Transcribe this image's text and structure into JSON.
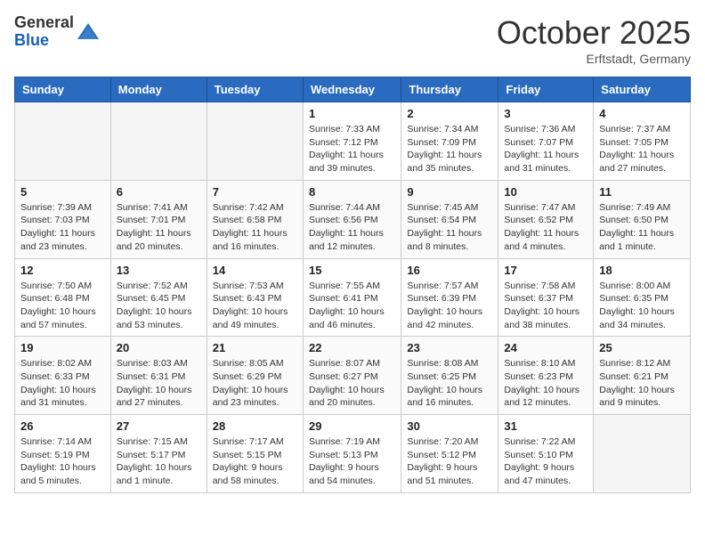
{
  "header": {
    "logo_general": "General",
    "logo_blue": "Blue",
    "month_title": "October 2025",
    "location": "Erftstadt, Germany"
  },
  "days_of_week": [
    "Sunday",
    "Monday",
    "Tuesday",
    "Wednesday",
    "Thursday",
    "Friday",
    "Saturday"
  ],
  "weeks": [
    [
      {
        "day": "",
        "info": ""
      },
      {
        "day": "",
        "info": ""
      },
      {
        "day": "",
        "info": ""
      },
      {
        "day": "1",
        "info": "Sunrise: 7:33 AM\nSunset: 7:12 PM\nDaylight: 11 hours and 39 minutes."
      },
      {
        "day": "2",
        "info": "Sunrise: 7:34 AM\nSunset: 7:09 PM\nDaylight: 11 hours and 35 minutes."
      },
      {
        "day": "3",
        "info": "Sunrise: 7:36 AM\nSunset: 7:07 PM\nDaylight: 11 hours and 31 minutes."
      },
      {
        "day": "4",
        "info": "Sunrise: 7:37 AM\nSunset: 7:05 PM\nDaylight: 11 hours and 27 minutes."
      }
    ],
    [
      {
        "day": "5",
        "info": "Sunrise: 7:39 AM\nSunset: 7:03 PM\nDaylight: 11 hours and 23 minutes."
      },
      {
        "day": "6",
        "info": "Sunrise: 7:41 AM\nSunset: 7:01 PM\nDaylight: 11 hours and 20 minutes."
      },
      {
        "day": "7",
        "info": "Sunrise: 7:42 AM\nSunset: 6:58 PM\nDaylight: 11 hours and 16 minutes."
      },
      {
        "day": "8",
        "info": "Sunrise: 7:44 AM\nSunset: 6:56 PM\nDaylight: 11 hours and 12 minutes."
      },
      {
        "day": "9",
        "info": "Sunrise: 7:45 AM\nSunset: 6:54 PM\nDaylight: 11 hours and 8 minutes."
      },
      {
        "day": "10",
        "info": "Sunrise: 7:47 AM\nSunset: 6:52 PM\nDaylight: 11 hours and 4 minutes."
      },
      {
        "day": "11",
        "info": "Sunrise: 7:49 AM\nSunset: 6:50 PM\nDaylight: 11 hours and 1 minute."
      }
    ],
    [
      {
        "day": "12",
        "info": "Sunrise: 7:50 AM\nSunset: 6:48 PM\nDaylight: 10 hours and 57 minutes."
      },
      {
        "day": "13",
        "info": "Sunrise: 7:52 AM\nSunset: 6:45 PM\nDaylight: 10 hours and 53 minutes."
      },
      {
        "day": "14",
        "info": "Sunrise: 7:53 AM\nSunset: 6:43 PM\nDaylight: 10 hours and 49 minutes."
      },
      {
        "day": "15",
        "info": "Sunrise: 7:55 AM\nSunset: 6:41 PM\nDaylight: 10 hours and 46 minutes."
      },
      {
        "day": "16",
        "info": "Sunrise: 7:57 AM\nSunset: 6:39 PM\nDaylight: 10 hours and 42 minutes."
      },
      {
        "day": "17",
        "info": "Sunrise: 7:58 AM\nSunset: 6:37 PM\nDaylight: 10 hours and 38 minutes."
      },
      {
        "day": "18",
        "info": "Sunrise: 8:00 AM\nSunset: 6:35 PM\nDaylight: 10 hours and 34 minutes."
      }
    ],
    [
      {
        "day": "19",
        "info": "Sunrise: 8:02 AM\nSunset: 6:33 PM\nDaylight: 10 hours and 31 minutes."
      },
      {
        "day": "20",
        "info": "Sunrise: 8:03 AM\nSunset: 6:31 PM\nDaylight: 10 hours and 27 minutes."
      },
      {
        "day": "21",
        "info": "Sunrise: 8:05 AM\nSunset: 6:29 PM\nDaylight: 10 hours and 23 minutes."
      },
      {
        "day": "22",
        "info": "Sunrise: 8:07 AM\nSunset: 6:27 PM\nDaylight: 10 hours and 20 minutes."
      },
      {
        "day": "23",
        "info": "Sunrise: 8:08 AM\nSunset: 6:25 PM\nDaylight: 10 hours and 16 minutes."
      },
      {
        "day": "24",
        "info": "Sunrise: 8:10 AM\nSunset: 6:23 PM\nDaylight: 10 hours and 12 minutes."
      },
      {
        "day": "25",
        "info": "Sunrise: 8:12 AM\nSunset: 6:21 PM\nDaylight: 10 hours and 9 minutes."
      }
    ],
    [
      {
        "day": "26",
        "info": "Sunrise: 7:14 AM\nSunset: 5:19 PM\nDaylight: 10 hours and 5 minutes."
      },
      {
        "day": "27",
        "info": "Sunrise: 7:15 AM\nSunset: 5:17 PM\nDaylight: 10 hours and 1 minute."
      },
      {
        "day": "28",
        "info": "Sunrise: 7:17 AM\nSunset: 5:15 PM\nDaylight: 9 hours and 58 minutes."
      },
      {
        "day": "29",
        "info": "Sunrise: 7:19 AM\nSunset: 5:13 PM\nDaylight: 9 hours and 54 minutes."
      },
      {
        "day": "30",
        "info": "Sunrise: 7:20 AM\nSunset: 5:12 PM\nDaylight: 9 hours and 51 minutes."
      },
      {
        "day": "31",
        "info": "Sunrise: 7:22 AM\nSunset: 5:10 PM\nDaylight: 9 hours and 47 minutes."
      },
      {
        "day": "",
        "info": ""
      }
    ]
  ]
}
